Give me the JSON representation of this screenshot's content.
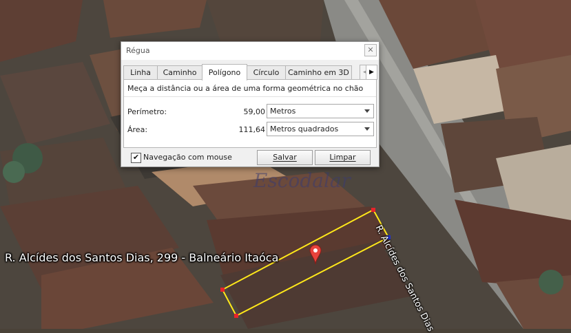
{
  "map": {
    "address_label": "R. Alcídes dos Santos Dias, 299 - Balneário Itaóca",
    "street_label": "R. Alcídes dos Santos Dias",
    "watermark": "Escodalar",
    "polygon_color": "#ffe81a",
    "vertex_color": "#e8232a",
    "active_vertex_color": "#2233cc",
    "pin_color": "#e8433c"
  },
  "dialog": {
    "title": "Régua",
    "close_icon": "close-icon",
    "tabs": [
      "Linha",
      "Caminho",
      "Polígono",
      "Círculo",
      "Caminho em 3D"
    ],
    "active_tab": "Polígono",
    "description": "Meça a distância ou a área de uma forma geométrica no chão",
    "perimeter": {
      "label": "Perímetro:",
      "value": "59,00",
      "unit": "Metros"
    },
    "area": {
      "label": "Área:",
      "value": "111,64",
      "unit": "Metros quadrados"
    },
    "mouse_nav": {
      "label": "Navegação com mouse",
      "checked": true
    },
    "save_label": "Salvar",
    "clear_label": "Limpar"
  }
}
